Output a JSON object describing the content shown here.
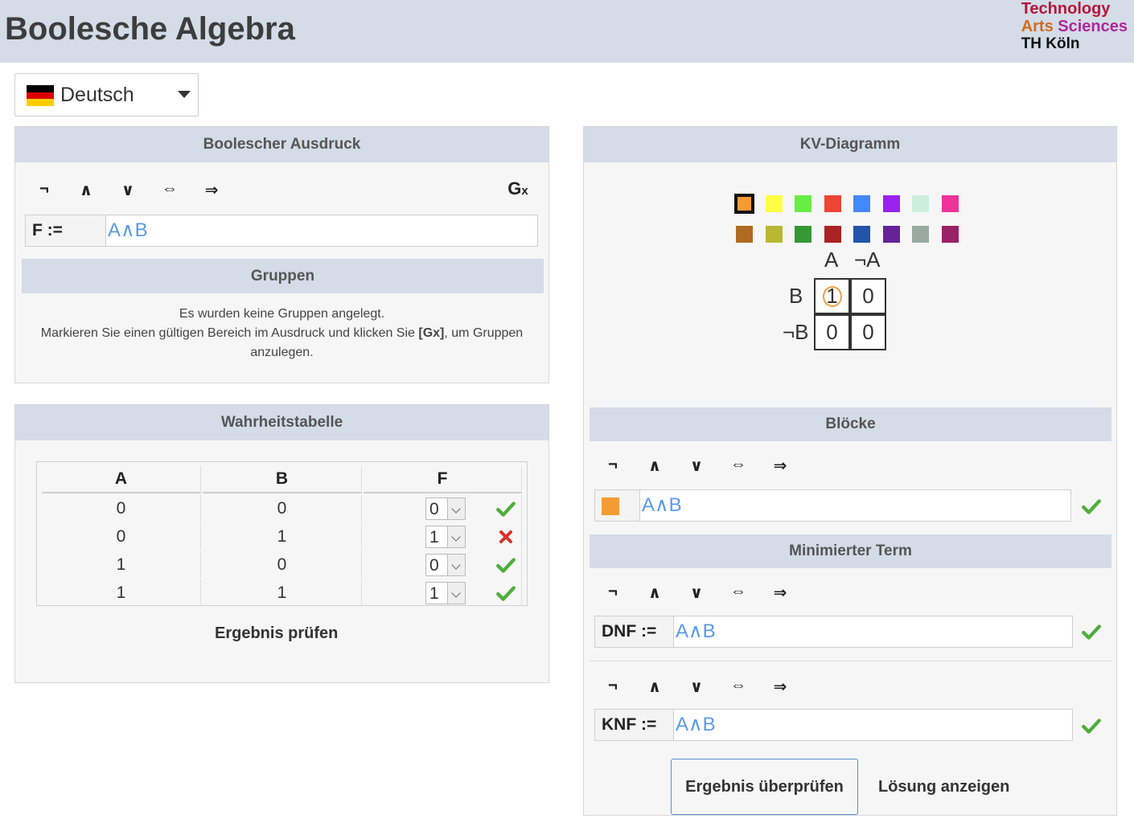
{
  "header": {
    "title": "Boolesche Algebra",
    "logo": {
      "line1": "Technology",
      "line2a": "Arts",
      "line2b": "Sciences",
      "line3": "TH Köln"
    }
  },
  "language": {
    "selected": "Deutsch"
  },
  "operators": {
    "not": "¬",
    "and": "∧",
    "or": "∨",
    "equiv": "⇔",
    "impl": "⇒",
    "group": "Gx"
  },
  "expression_panel": {
    "title": "Boolescher Ausdruck",
    "label": "F :=",
    "value": "A∧B",
    "groups_title": "Gruppen",
    "groups_line1": "Es wurden keine Gruppen angelegt.",
    "groups_line2a": "Markieren Sie einen gültigen Bereich im Ausdruck und klicken Sie ",
    "groups_line2b": "[Gx]",
    "groups_line2c": ", um Gruppen",
    "groups_line3": "anzulegen."
  },
  "truth_table": {
    "title": "Wahrheitstabelle",
    "headers": [
      "A",
      "B",
      "F"
    ],
    "rows": [
      {
        "a": "0",
        "b": "0",
        "f": "0",
        "status": "correct"
      },
      {
        "a": "0",
        "b": "1",
        "f": "1",
        "status": "wrong"
      },
      {
        "a": "1",
        "b": "0",
        "f": "0",
        "status": "correct"
      },
      {
        "a": "1",
        "b": "1",
        "f": "1",
        "status": "correct"
      }
    ],
    "check_label": "Ergebnis prüfen"
  },
  "kv_panel": {
    "title": "KV-Diagramm",
    "colors_row1": [
      "#f39c33",
      "#ffff44",
      "#66ee44",
      "#ee4433",
      "#4488ff",
      "#9922ee",
      "#cceedd",
      "#ee3399"
    ],
    "colors_row2": [
      "#b06a22",
      "#b8b833",
      "#339933",
      "#aa2222",
      "#2255aa",
      "#662299",
      "#99aaa0",
      "#992266"
    ],
    "col_labels": [
      "A",
      "¬A"
    ],
    "row_labels": [
      "B",
      "¬B"
    ],
    "cells": [
      [
        "1",
        "0"
      ],
      [
        "0",
        "0"
      ]
    ],
    "blocks_title": "Blöcke",
    "block_color": "#f39c33",
    "block_value": "A∧B",
    "min_title": "Minimierter Term",
    "dnf_label": "DNF :=",
    "dnf_value": "A∧B",
    "knf_label": "KNF :=",
    "knf_value": "A∧B",
    "verify_label": "Ergebnis überprüfen",
    "solution_label": "Lösung anzeigen"
  }
}
